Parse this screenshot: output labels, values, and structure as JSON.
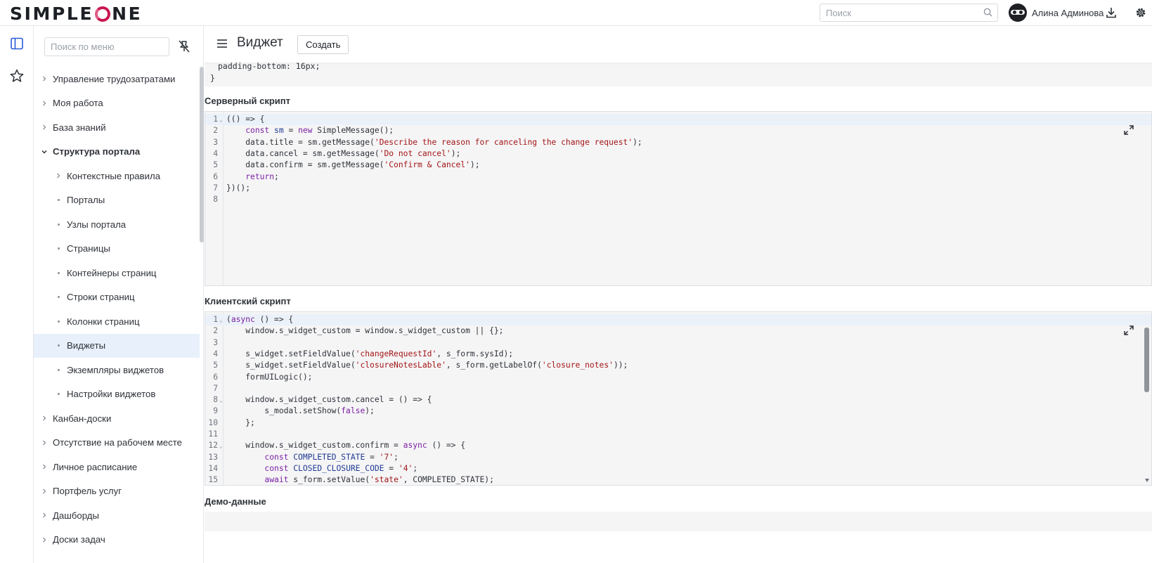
{
  "header": {
    "logo_text_left": "SIMPLE",
    "logo_text_right": "NE",
    "search_placeholder": "Поиск",
    "user_name": "Алина Админова",
    "icons": [
      "search-icon",
      "download-icon",
      "gear-icon"
    ]
  },
  "rail": {
    "icons": [
      "sidebar-toggle-icon",
      "star-icon"
    ]
  },
  "menu": {
    "search_placeholder": "Поиск по меню",
    "pin_icon": "unpin-icon",
    "items": [
      {
        "label": "Управление трудозатратами",
        "level": 1,
        "marker": "chevron-right"
      },
      {
        "label": "Моя работа",
        "level": 1,
        "marker": "chevron-right"
      },
      {
        "label": "База знаний",
        "level": 1,
        "marker": "chevron-right"
      },
      {
        "label": "Структура портала",
        "level": 1,
        "marker": "chevron-down",
        "open": true
      },
      {
        "label": "Контекстные правила",
        "level": 2,
        "marker": "chevron-right"
      },
      {
        "label": "Порталы",
        "level": 2,
        "marker": "dot"
      },
      {
        "label": "Узлы портала",
        "level": 2,
        "marker": "dot"
      },
      {
        "label": "Страницы",
        "level": 2,
        "marker": "dot"
      },
      {
        "label": "Контейнеры страниц",
        "level": 2,
        "marker": "dot"
      },
      {
        "label": "Строки страниц",
        "level": 2,
        "marker": "dot"
      },
      {
        "label": "Колонки страниц",
        "level": 2,
        "marker": "dot"
      },
      {
        "label": "Виджеты",
        "level": 2,
        "marker": "dot",
        "active": true
      },
      {
        "label": "Экземпляры виджетов",
        "level": 2,
        "marker": "dot"
      },
      {
        "label": "Настройки виджетов",
        "level": 2,
        "marker": "dot"
      },
      {
        "label": "Канбан-доски",
        "level": 1,
        "marker": "chevron-right"
      },
      {
        "label": "Отсутствие на рабочем месте",
        "level": 1,
        "marker": "chevron-right"
      },
      {
        "label": "Личное расписание",
        "level": 1,
        "marker": "chevron-right"
      },
      {
        "label": "Портфель услуг",
        "level": 1,
        "marker": "chevron-right"
      },
      {
        "label": "Дашборды",
        "level": 1,
        "marker": "chevron-right"
      },
      {
        "label": "Доски задач",
        "level": 1,
        "marker": "chevron-right"
      }
    ]
  },
  "main": {
    "title": "Виджет",
    "create_label": "Создать",
    "css_tail": {
      "line1": "padding-bottom: 16px;",
      "line2": "}"
    },
    "server_script": {
      "label": "Серверный скрипт",
      "lines": [
        {
          "n": "1",
          "fold": true,
          "tokens": [
            [
              "p",
              "(() => {"
            ]
          ]
        },
        {
          "n": "2",
          "tokens": [
            [
              "p",
              "    "
            ],
            [
              "kw",
              "const"
            ],
            [
              "p",
              " "
            ],
            [
              "var",
              "sm"
            ],
            [
              "p",
              " = "
            ],
            [
              "kw",
              "new"
            ],
            [
              "p",
              " SimpleMessage();"
            ]
          ]
        },
        {
          "n": "3",
          "tokens": [
            [
              "p",
              "    data.title = sm.getMessage("
            ],
            [
              "str",
              "'Describe the reason for canceling the change request'"
            ],
            [
              "p",
              ");"
            ]
          ]
        },
        {
          "n": "4",
          "tokens": [
            [
              "p",
              "    data.cancel = sm.getMessage("
            ],
            [
              "str",
              "'Do not cancel'"
            ],
            [
              "p",
              ");"
            ]
          ]
        },
        {
          "n": "5",
          "tokens": [
            [
              "p",
              "    data.confirm = sm.getMessage("
            ],
            [
              "str",
              "'Confirm & Cancel'"
            ],
            [
              "p",
              ");"
            ]
          ]
        },
        {
          "n": "6",
          "tokens": [
            [
              "p",
              "    "
            ],
            [
              "kw",
              "return"
            ],
            [
              "p",
              ";"
            ]
          ]
        },
        {
          "n": "7",
          "tokens": [
            [
              "p",
              "})();"
            ]
          ]
        },
        {
          "n": "8",
          "tokens": [
            [
              "p",
              ""
            ]
          ]
        }
      ]
    },
    "client_script": {
      "label": "Клиентский скрипт",
      "lines": [
        {
          "n": "1",
          "fold": true,
          "tokens": [
            [
              "p",
              "("
            ],
            [
              "kw",
              "async"
            ],
            [
              "p",
              " () => {"
            ]
          ]
        },
        {
          "n": "2",
          "tokens": [
            [
              "p",
              "    window.s_widget_custom = window.s_widget_custom || {};"
            ]
          ]
        },
        {
          "n": "3",
          "tokens": [
            [
              "p",
              ""
            ]
          ]
        },
        {
          "n": "4",
          "tokens": [
            [
              "p",
              "    s_widget.setFieldValue("
            ],
            [
              "str",
              "'changeRequestId'"
            ],
            [
              "p",
              ", s_form.sysId);"
            ]
          ]
        },
        {
          "n": "5",
          "tokens": [
            [
              "p",
              "    s_widget.setFieldValue("
            ],
            [
              "str",
              "'closureNotesLable'"
            ],
            [
              "p",
              ", s_form.getLabelOf("
            ],
            [
              "str",
              "'closure_notes'"
            ],
            [
              "p",
              "));"
            ]
          ]
        },
        {
          "n": "6",
          "tokens": [
            [
              "p",
              "    formUILogic();"
            ]
          ]
        },
        {
          "n": "7",
          "tokens": [
            [
              "p",
              ""
            ]
          ]
        },
        {
          "n": "8",
          "fold": true,
          "tokens": [
            [
              "p",
              "    window.s_widget_custom.cancel = () => {"
            ]
          ]
        },
        {
          "n": "9",
          "tokens": [
            [
              "p",
              "        s_modal.setShow("
            ],
            [
              "kw",
              "false"
            ],
            [
              "p",
              ");"
            ]
          ]
        },
        {
          "n": "10",
          "tokens": [
            [
              "p",
              "    };"
            ]
          ]
        },
        {
          "n": "11",
          "tokens": [
            [
              "p",
              ""
            ]
          ]
        },
        {
          "n": "12",
          "fold": true,
          "tokens": [
            [
              "p",
              "    window.s_widget_custom.confirm = "
            ],
            [
              "kw",
              "async"
            ],
            [
              "p",
              " () => {"
            ]
          ]
        },
        {
          "n": "13",
          "tokens": [
            [
              "p",
              "        "
            ],
            [
              "kw",
              "const"
            ],
            [
              "p",
              " "
            ],
            [
              "var",
              "COMPLETED_STATE"
            ],
            [
              "p",
              " = "
            ],
            [
              "str",
              "'7'"
            ],
            [
              "p",
              ";"
            ]
          ]
        },
        {
          "n": "14",
          "tokens": [
            [
              "p",
              "        "
            ],
            [
              "kw",
              "const"
            ],
            [
              "p",
              " "
            ],
            [
              "var",
              "CLOSED_CLOSURE_CODE"
            ],
            [
              "p",
              " = "
            ],
            [
              "str",
              "'4'"
            ],
            [
              "p",
              ";"
            ]
          ]
        },
        {
          "n": "15",
          "tokens": [
            [
              "p",
              "        "
            ],
            [
              "kw",
              "await"
            ],
            [
              "p",
              " s_form.setValue("
            ],
            [
              "str",
              "'state'"
            ],
            [
              "p",
              ", COMPLETED_STATE);"
            ]
          ]
        }
      ]
    },
    "demo_label": "Демо-данные"
  }
}
